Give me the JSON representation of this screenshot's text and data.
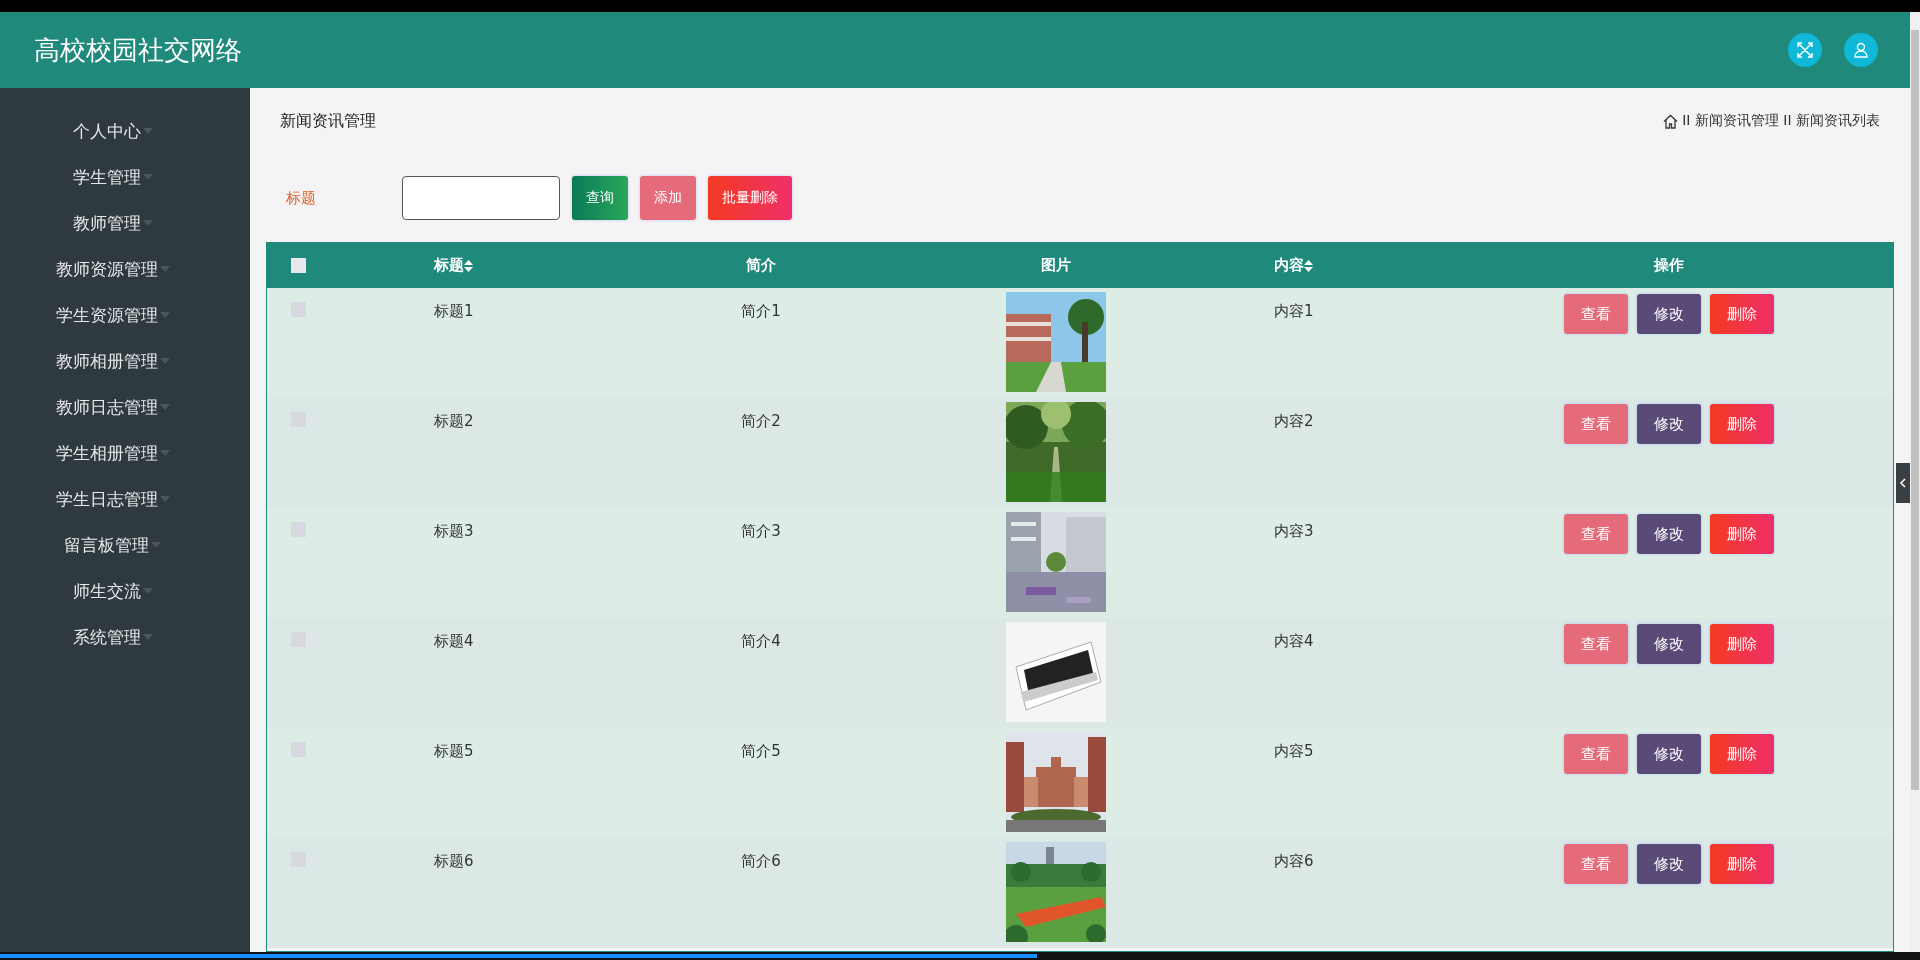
{
  "header": {
    "title": "高校校园社交网络"
  },
  "player": {
    "level": 0.54
  },
  "sidebar": {
    "items": [
      {
        "label": "个人中心"
      },
      {
        "label": "学生管理"
      },
      {
        "label": "教师管理"
      },
      {
        "label": "教师资源管理"
      },
      {
        "label": "学生资源管理"
      },
      {
        "label": "教师相册管理"
      },
      {
        "label": "教师日志管理"
      },
      {
        "label": "学生相册管理"
      },
      {
        "label": "学生日志管理"
      },
      {
        "label": "留言板管理"
      },
      {
        "label": "师生交流"
      },
      {
        "label": "系统管理"
      }
    ]
  },
  "page_title": "新闻资讯管理",
  "breadcrumb": [
    "II 新闻资讯管理 II 新闻资讯列表"
  ],
  "search": {
    "label": "标题",
    "buttons": [
      "查询",
      "添加",
      "批量删除"
    ]
  },
  "table": {
    "all_checked": false,
    "columns": [
      {
        "label": "标题",
        "sortable": true
      },
      {
        "label": "简介",
        "sortable": false
      },
      {
        "label": "图片",
        "sortable": false
      },
      {
        "label": "内容",
        "sortable": true
      },
      {
        "label": "操作",
        "sortable": false
      }
    ],
    "rows": [
      {
        "checked": false,
        "title": "标题1",
        "summary": "简介1",
        "content": "内容1",
        "actions": [
          "查看",
          "修改",
          "删除"
        ]
      },
      {
        "checked": false,
        "title": "标题2",
        "summary": "简介2",
        "content": "内容2",
        "actions": [
          "查看",
          "修改",
          "删除"
        ]
      },
      {
        "checked": false,
        "title": "标题3",
        "summary": "简介3",
        "content": "内容3",
        "actions": [
          "查看",
          "修改",
          "删除"
        ]
      },
      {
        "checked": false,
        "title": "标题4",
        "summary": "简介4",
        "content": "内容4",
        "actions": [
          "查看",
          "修改",
          "删除"
        ]
      },
      {
        "checked": false,
        "title": "标题5",
        "summary": "简介5",
        "content": "内容5",
        "actions": [
          "查看",
          "修改",
          "删除"
        ]
      },
      {
        "checked": false,
        "title": "标题6",
        "summary": "简介6",
        "content": "内容6",
        "actions": [
          "查看",
          "修改",
          "删除"
        ]
      }
    ]
  }
}
